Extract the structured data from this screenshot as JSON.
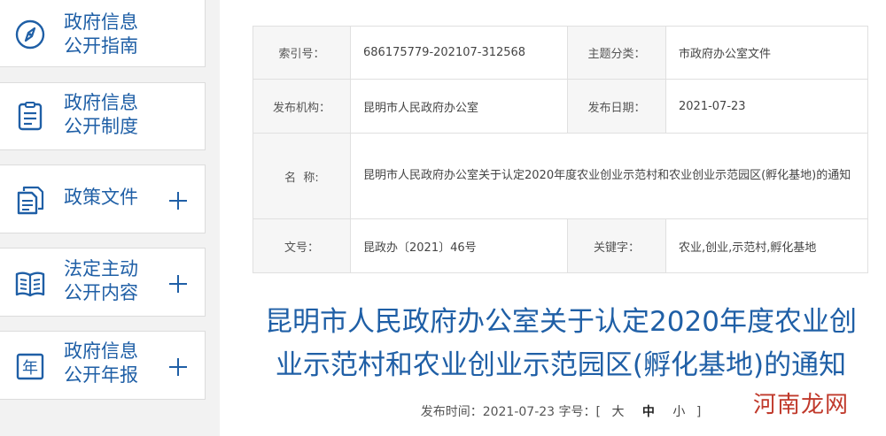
{
  "sidebar": {
    "items": [
      {
        "label": "政府信息\n公开指南",
        "icon": "compass-icon",
        "expandable": false
      },
      {
        "label": "政府信息\n公开制度",
        "icon": "document-list-icon",
        "expandable": false
      },
      {
        "label": "政策文件",
        "icon": "files-icon",
        "expandable": true
      },
      {
        "label": "法定主动\n公开内容",
        "icon": "open-book-icon",
        "expandable": true
      },
      {
        "label": "政府信息\n公开年报",
        "icon": "year-report-icon",
        "icon_text": "年",
        "expandable": true
      }
    ],
    "accent_color": "#1f5fa6"
  },
  "meta_table": {
    "index_label": "索引号：",
    "index_value": "686175779-202107-312568",
    "topic_label": "主题分类：",
    "topic_value": "市政府办公室文件",
    "publisher_label": "发布机构：",
    "publisher_value": "昆明市人民政府办公室",
    "date_label": "发布日期：",
    "date_value": "2021-07-23",
    "name_label": "名  称:",
    "name_value": "昆明市人民政府办公室关于认定2020年度农业创业示范村和农业创业示范园区(孵化基地)的通知",
    "docno_label": "文号：",
    "docno_value": "昆政办〔2021〕46号",
    "keywords_label": "关键字：",
    "keywords_value": "农业,创业,示范村,孵化基地"
  },
  "document": {
    "title": "昆明市人民政府办公室关于认定2020年度农业创业示范村和农业创业示范园区(孵化基地)的通知",
    "publish_time_label": "发布时间：",
    "publish_time": "2021-07-23",
    "font_size_label": "字号：",
    "bracket_open": "[",
    "bracket_close": "]",
    "font_sizes": [
      "大",
      "中",
      "小"
    ],
    "active_font_size": "中"
  },
  "watermark": "河南龙网"
}
